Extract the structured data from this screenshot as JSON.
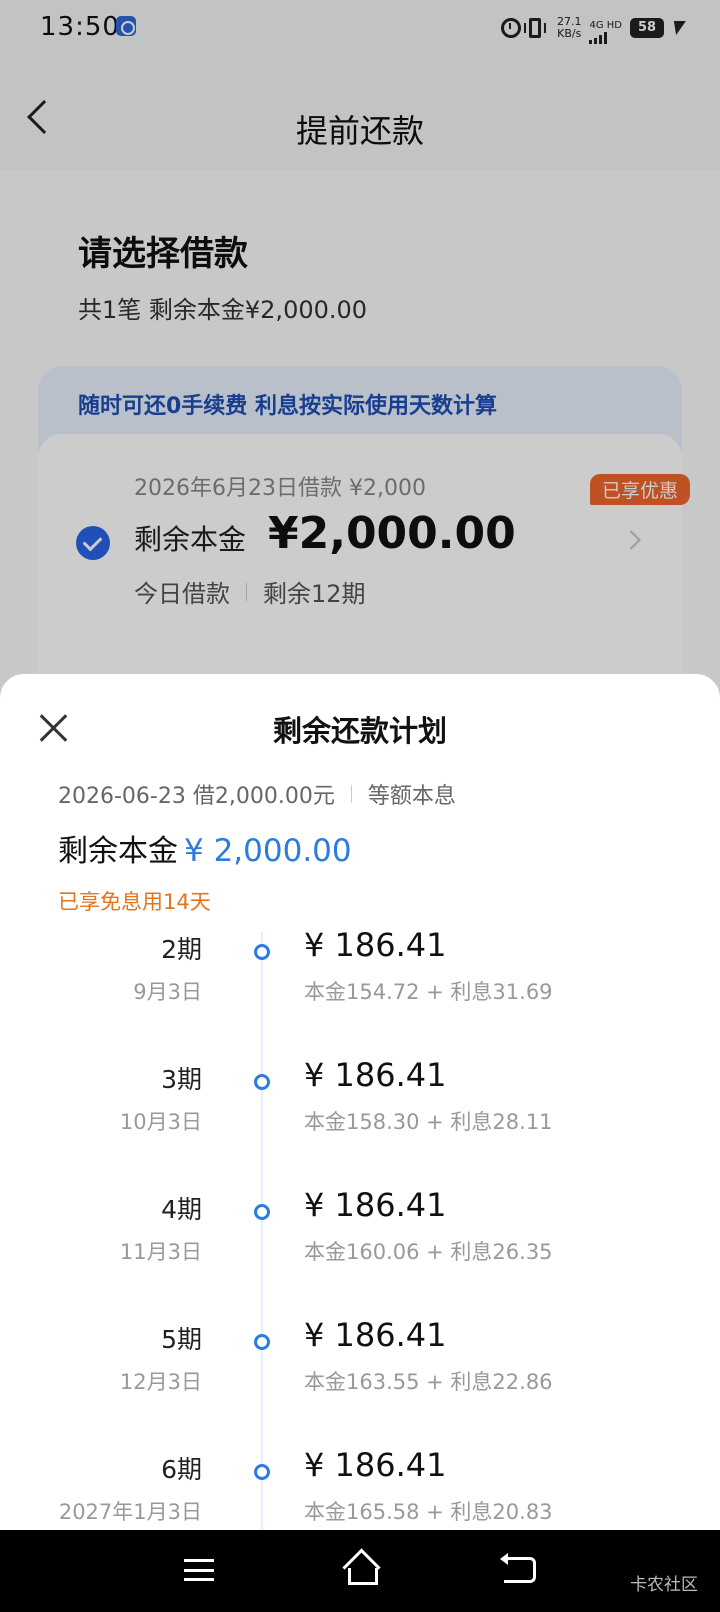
{
  "status_bar": {
    "time": "13:50",
    "net_speed_value": "27.1",
    "net_speed_unit": "KB/s",
    "network_label": "4G HD",
    "battery": "58"
  },
  "header": {
    "title": "提前还款"
  },
  "select": {
    "title": "请选择借款",
    "summary": "共1笔 剩余本金¥2,000.00"
  },
  "promo": {
    "text": "随时可还0手续费 利息按实际使用天数计算"
  },
  "loan_card": {
    "meta": "2026年6月23日借款 ¥2,000",
    "label": "剩余本金",
    "amount": "¥2,000.00",
    "badge": "已享优惠",
    "sub_left": "今日借款",
    "sub_right": "剩余12期"
  },
  "sheet": {
    "title": "剩余还款计划",
    "loan_info": "2026-06-23 借2,000.00元",
    "method": "等额本息",
    "remaining_label": "剩余本金",
    "remaining_amount": "¥ 2,000.00",
    "free_interest": "已享免息用14天",
    "schedule": [
      {
        "period": "2期",
        "date": "9月3日",
        "amount": "¥ 186.41",
        "detail": "本金154.72 + 利息31.69"
      },
      {
        "period": "3期",
        "date": "10月3日",
        "amount": "¥ 186.41",
        "detail": "本金158.30 + 利息28.11"
      },
      {
        "period": "4期",
        "date": "11月3日",
        "amount": "¥ 186.41",
        "detail": "本金160.06 + 利息26.35"
      },
      {
        "period": "5期",
        "date": "12月3日",
        "amount": "¥ 186.41",
        "detail": "本金163.55 + 利息22.86"
      },
      {
        "period": "6期",
        "date": "2027年1月3日",
        "amount": "¥ 186.41",
        "detail": "本金165.58 + 利息20.83"
      }
    ]
  },
  "watermark": "卡农社区",
  "colors": {
    "accent_blue": "#2b7be0",
    "check_blue": "#2863e6",
    "badge_orange": "#f0662c",
    "free_interest_orange": "#e5741b"
  }
}
